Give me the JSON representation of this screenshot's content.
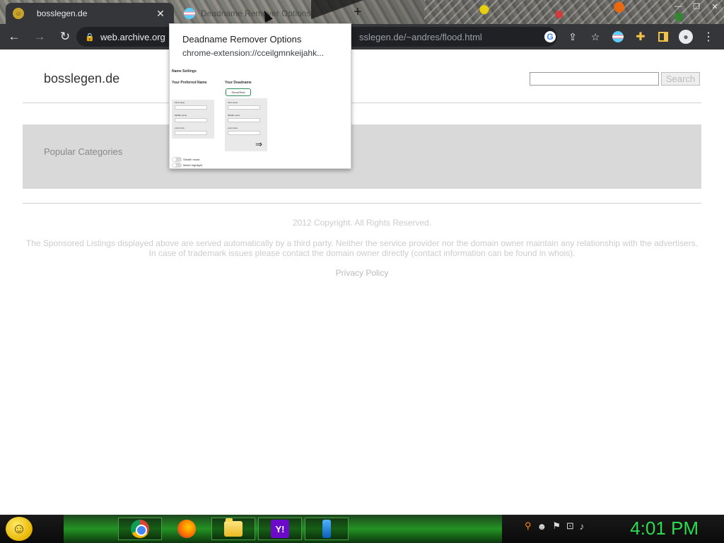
{
  "browser": {
    "tabs": [
      {
        "title": "bosslegen.de",
        "active": true
      },
      {
        "title": "Deadname Remover Options",
        "active": false
      }
    ],
    "url_host": "web.archive.org",
    "url_rest": "sslegen.de/~andres/flood.html"
  },
  "page": {
    "site_title": "bosslegen.de",
    "search_placeholder": "",
    "search_button": "Search",
    "categories_label": "Popular Categories",
    "copyright": "2012 Copyright. All Rights Reserved.",
    "disclaimer_line1": "The Sponsored Listings displayed above are served automatically by a third party. Neither the service provider nor the domain owner maintain any relationship with the advertisers.",
    "disclaimer_line2": "In case of trademark issues please contact the domain owner directly (contact information can be found in whois).",
    "privacy_policy": "Privacy Policy"
  },
  "popup": {
    "title": "Deadname Remover Options",
    "url": "chrome-extension://cceilgmnkeijahk...",
    "preview": {
      "heading": "Name Settings",
      "preferred": "Your Preferred Name",
      "deadname": "Your Deadname",
      "button": "Show/Hide",
      "field1": "First name",
      "field2": "Middle name",
      "field3": "Last name",
      "arrow": "⇒",
      "toggle1": "Stealth mode",
      "toggle2": "Match highlight"
    }
  },
  "taskbar": {
    "clock": "4:01 PM"
  }
}
